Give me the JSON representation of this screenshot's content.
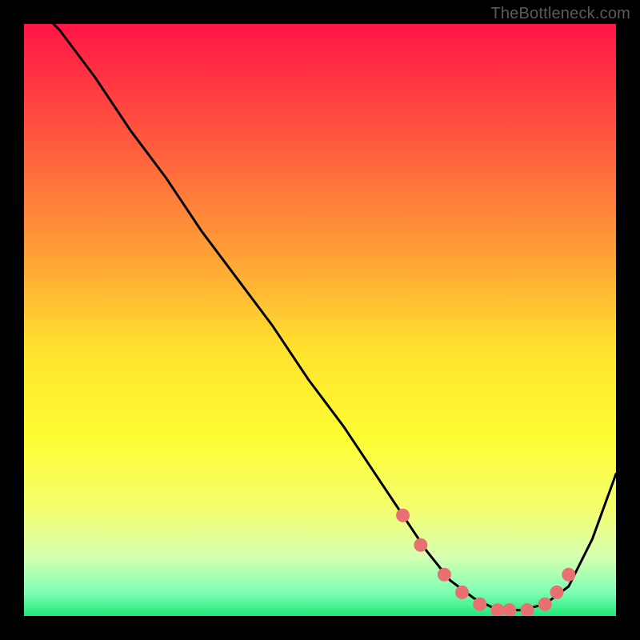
{
  "watermark": "TheBottleneck.com",
  "colors": {
    "background": "#000000",
    "curve": "#000000",
    "marker": "#e97070",
    "gradient_stops": [
      {
        "offset": 0.0,
        "color": "#ff1547"
      },
      {
        "offset": 0.2,
        "color": "#ff5a3e"
      },
      {
        "offset": 0.4,
        "color": "#ffa436"
      },
      {
        "offset": 0.55,
        "color": "#ffe22e"
      },
      {
        "offset": 0.7,
        "color": "#fdfd33"
      },
      {
        "offset": 0.82,
        "color": "#f4ff70"
      },
      {
        "offset": 0.9,
        "color": "#d6ffb0"
      },
      {
        "offset": 0.96,
        "color": "#7dffb5"
      },
      {
        "offset": 1.0,
        "color": "#20e878"
      }
    ]
  },
  "chart_data": {
    "type": "line",
    "title": "",
    "xlabel": "",
    "ylabel": "",
    "xlim": [
      0,
      100
    ],
    "ylim": [
      0,
      100
    ],
    "grid": false,
    "series": [
      {
        "name": "curve",
        "x": [
          0,
          6,
          12,
          18,
          24,
          30,
          36,
          42,
          48,
          54,
          60,
          64,
          68,
          72,
          76,
          80,
          84,
          88,
          92,
          96,
          100
        ],
        "y": [
          105,
          99,
          91,
          82,
          74,
          65,
          57,
          49,
          40,
          32,
          23,
          17,
          11,
          6,
          3,
          1,
          1,
          2,
          5,
          13,
          24
        ]
      }
    ],
    "markers": {
      "name": "highlight-points",
      "x": [
        64,
        67,
        71,
        74,
        77,
        80,
        82,
        85,
        88,
        90,
        92
      ],
      "y": [
        17,
        12,
        7,
        4,
        2,
        1,
        1,
        1,
        2,
        4,
        7
      ]
    }
  }
}
